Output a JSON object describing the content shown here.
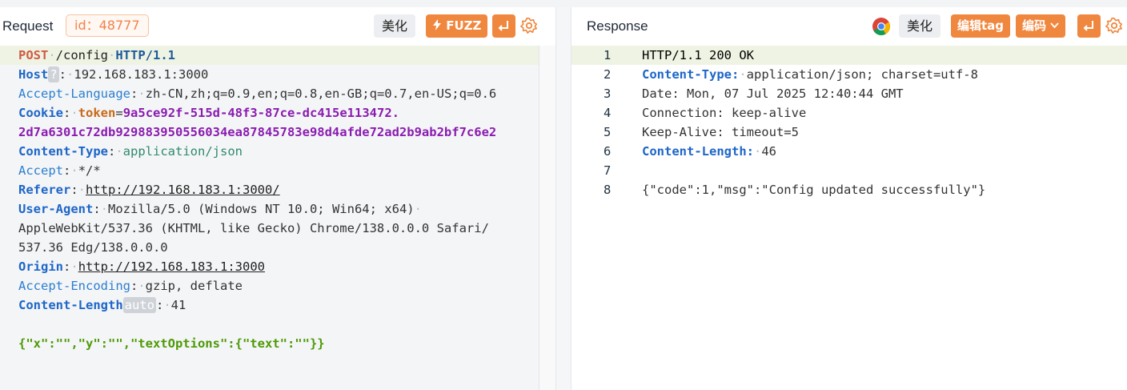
{
  "request": {
    "title": "Request",
    "id_badge": "id：48777",
    "beautify_label": "美化",
    "fuzz_label": "FUZZ",
    "lines": {
      "l1": {
        "method": "POST",
        "path": "/config",
        "version": "HTTP/1.1"
      },
      "l2": {
        "name": "Host",
        "hint": "?",
        "sep": ":",
        "value": "192.168.183.1:3000"
      },
      "l3": {
        "name": "Accept-Language",
        "sep": ":",
        "value": "zh-CN,zh;q=0.9,en;q=0.8,en-GB;q=0.7,en-US;q=0.6"
      },
      "l4": {
        "name": "Cookie",
        "sep": ":",
        "cookie_key": "token",
        "eq": "=",
        "cookie_val1": "9a5ce92f-515d-48f3-87ce-dc415e113472."
      },
      "l5": {
        "cookie_val2": "2d7a6301c72db929883950556034ea87845783e98d4afde72ad2b9ab2bf7c6e2"
      },
      "l6": {
        "name": "Content-Type",
        "sep": ":",
        "value": "application/json"
      },
      "l7": {
        "name": "Accept",
        "sep": ":",
        "value": "*/*"
      },
      "l8": {
        "name": "Referer",
        "sep": ":",
        "value": "http://192.168.183.1:3000/"
      },
      "l9": {
        "name": "User-Agent",
        "sep": ":",
        "value": "Mozilla/5.0 (Windows NT 10.0; Win64; x64)"
      },
      "l10": {
        "value": "AppleWebKit/537.36 (KHTML, like Gecko) Chrome/138.0.0.0 Safari/"
      },
      "l11": {
        "value": "537.36 Edg/138.0.0.0"
      },
      "l12": {
        "name": "Origin",
        "sep": ":",
        "value": "http://192.168.183.1:3000"
      },
      "l13": {
        "name": "Accept-Encoding",
        "sep": ":",
        "value": "gzip, deflate"
      },
      "l14": {
        "name": "Content-Length",
        "tag": "auto",
        "sep": ":",
        "value": "41"
      },
      "l16": {
        "body": "{\"x\":\"\",\"y\":\"\",\"textOptions\":{\"text\":\"\"}}"
      }
    }
  },
  "response": {
    "title": "Response",
    "beautify_label": "美化",
    "edit_tag_label": "编辑tag",
    "encoding_label": "编码",
    "lines": [
      {
        "num": "1",
        "text": "HTTP/1.1 200 OK"
      },
      {
        "num": "2",
        "name": "Content-Type:",
        "value": "application/json; charset=utf-8"
      },
      {
        "num": "3",
        "text": "Date: Mon, 07 Jul 2025 12:40:44 GMT"
      },
      {
        "num": "4",
        "text": "Connection: keep-alive"
      },
      {
        "num": "5",
        "text": "Keep-Alive: timeout=5"
      },
      {
        "num": "6",
        "name": "Content-Length:",
        "value": "46"
      },
      {
        "num": "7",
        "text": ""
      },
      {
        "num": "8",
        "text": "{\"code\":1,\"msg\":\"Config updated successfully\"}"
      }
    ]
  },
  "colors": {
    "accent": "#f0873f",
    "line_highlight": "#eff3e3"
  },
  "icons": [
    "lightning-icon",
    "enter-icon",
    "gear-icon",
    "chrome-icon",
    "chevron-down-icon"
  ]
}
